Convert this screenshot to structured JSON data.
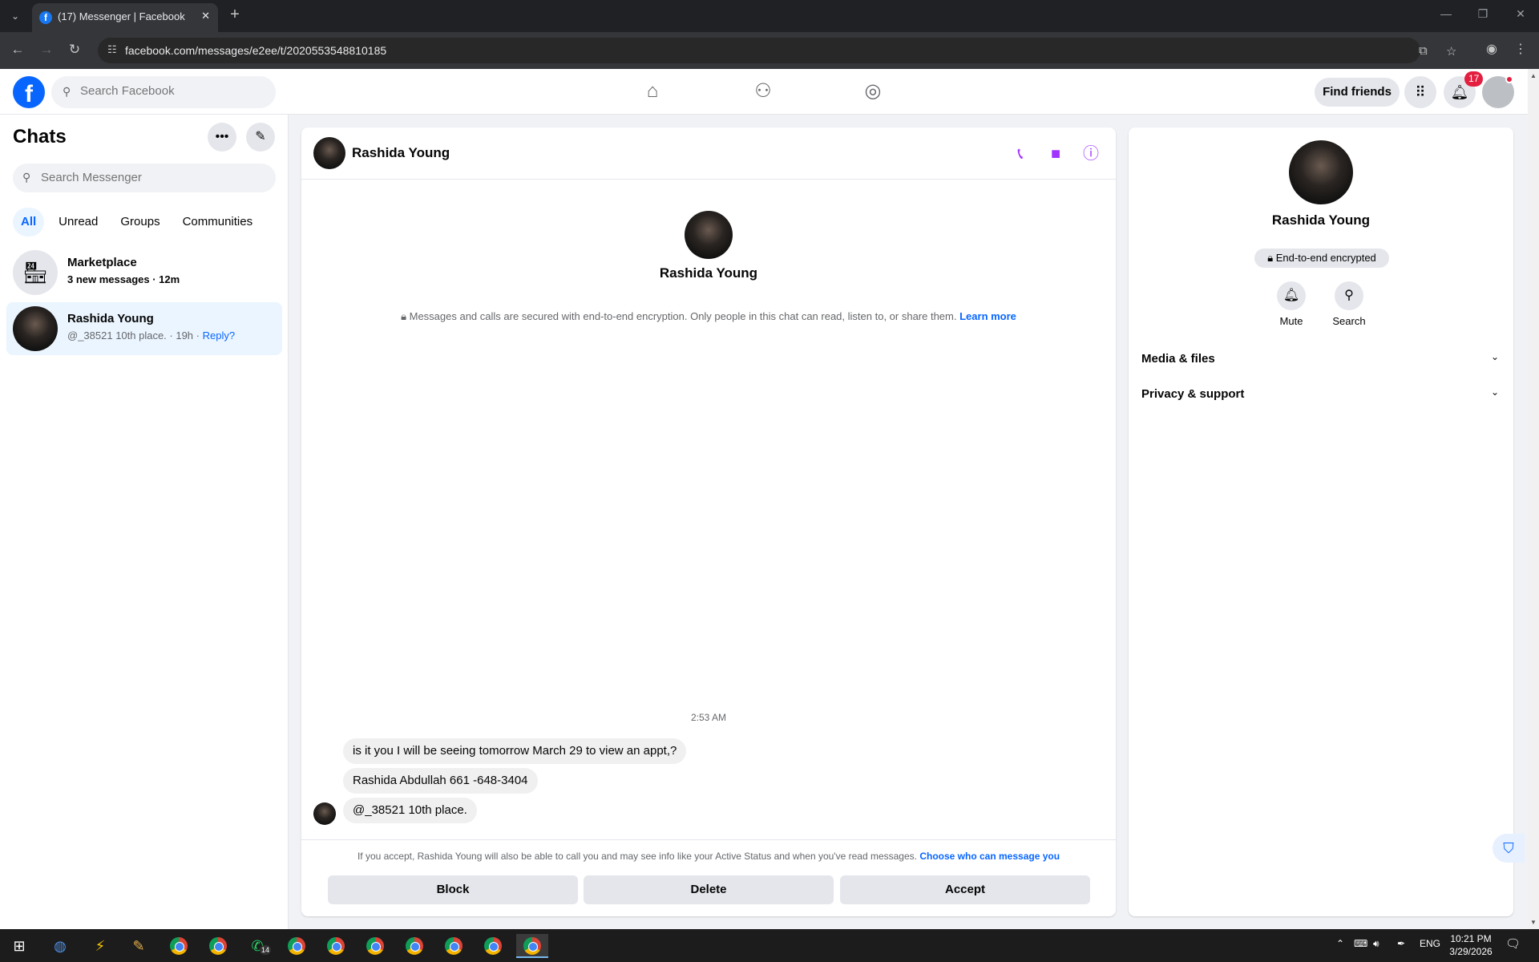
{
  "browser": {
    "tab_title": "(17) Messenger | Facebook",
    "url": "facebook.com/messages/e2ee/t/2020553548810185",
    "icons": [
      "tab-list-icon",
      "new-tab-icon",
      "minimize-icon",
      "restore-icon",
      "close-window-icon",
      "back-icon",
      "forward-icon",
      "reload-icon",
      "site-info-icon",
      "install-app-icon",
      "bookmark-star-icon",
      "profile-icon",
      "menu-kebab-icon"
    ]
  },
  "fb_nav": {
    "search_placeholder": "Search Facebook",
    "find_friends": "Find friends",
    "notification_count": "17",
    "icons": [
      "facebook-logo-icon",
      "home-icon",
      "friends-icon",
      "groups-icon",
      "menu-grid-icon",
      "notifications-bell-icon"
    ]
  },
  "sidebar": {
    "title": "Chats",
    "search_placeholder": "Search Messenger",
    "filters": [
      "All",
      "Unread",
      "Groups",
      "Communities"
    ],
    "chats": [
      {
        "name": "Marketplace",
        "preview": "3 new messages · 12m"
      },
      {
        "name": "Rashida Young",
        "preview": "@_38521 10th place. · 19h · ",
        "reply": "Reply?"
      }
    ]
  },
  "conversation": {
    "contact_name": "Rashida Young",
    "e2ee_note": "Messages and calls are secured with end-to-end encryption. Only people in this chat can read, listen to, or share them.",
    "learn_more": "Learn more",
    "timestamp": "2:53 AM",
    "messages": [
      "is it you I will be seeing tomorrow March 29 to view an appt,?",
      "Rashida Abdullah 661 -648-3404",
      "@_38521 10th place."
    ],
    "request_note": "If you accept, Rashida Young will also be able to call you and may see info like your Active Status and when you've read messages.",
    "request_link": "Choose who can message you",
    "buttons": {
      "block": "Block",
      "delete": "Delete",
      "accept": "Accept"
    }
  },
  "info_panel": {
    "name": "Rashida Young",
    "e2ee_badge": "End-to-end encrypted",
    "actions": {
      "mute": "Mute",
      "search": "Search"
    },
    "sections": [
      "Media & files",
      "Privacy & support"
    ]
  },
  "taskbar": {
    "whatsapp_badge": "14",
    "lang": "ENG",
    "time": "10:21 PM",
    "date": "3/29/2026"
  },
  "colors": {
    "brand_blue": "#0866ff",
    "messenger_purple": "#a033ff",
    "notification_red": "#e41e3f",
    "active_chat_bg": "#ebf5ff"
  }
}
